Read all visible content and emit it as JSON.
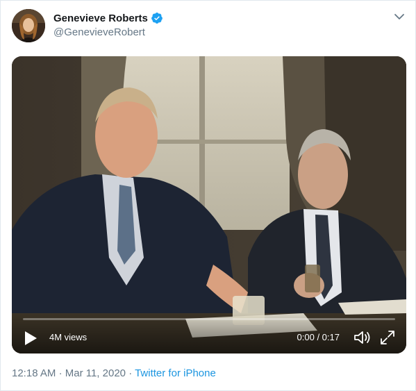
{
  "tweet": {
    "display_name": "Genevieve Roberts",
    "handle": "@GenevieveRobert",
    "verified_icon": "verified-badge-icon",
    "menu_icon": "chevron-down-icon"
  },
  "video": {
    "views": "4M views",
    "time": "0:00 / 0:17",
    "progress": 0.0,
    "icons": {
      "play": "play-icon",
      "volume": "speaker-icon",
      "expand": "expand-icon"
    }
  },
  "meta": {
    "time": "12:18 AM",
    "separator": "·",
    "date": "Mar 11, 2020",
    "source": "Twitter for iPhone"
  },
  "colors": {
    "text_primary": "#14171a",
    "text_secondary": "#657786",
    "link": "#1b95e0",
    "verified": "#1da1f2"
  }
}
